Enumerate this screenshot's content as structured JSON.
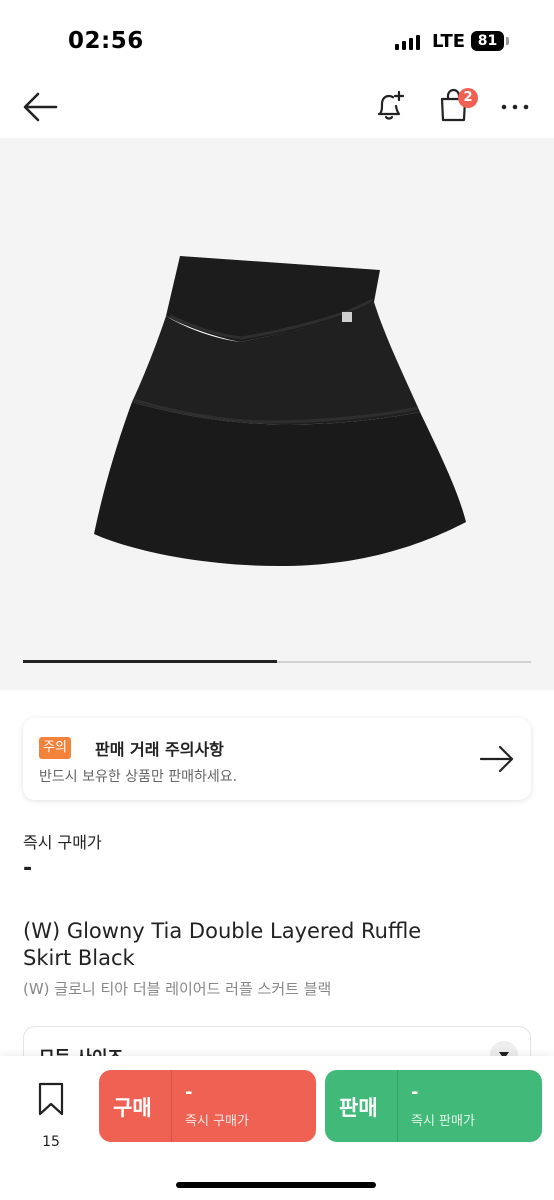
{
  "status_bar": {
    "time": "02:56",
    "network": "LTE",
    "battery": "81"
  },
  "nav": {
    "cart_badge": "2",
    "icons": [
      "back-arrow-icon",
      "bell-plus-icon",
      "shopping-bag-icon",
      "more-icon"
    ]
  },
  "carousel": {
    "progress": 0.5
  },
  "notice": {
    "tag": "주의",
    "title": "판매 거래 주의사항",
    "subtitle": "반드시 보유한 상품만 판매하세요."
  },
  "price": {
    "label": "즉시 구매가",
    "value": "-"
  },
  "product": {
    "title": "(W) Glowny Tia Double Layered Ruffle Skirt Black",
    "subtitle": "(W) 글로니 티아 더블 레이어드 러플 스커트 블랙"
  },
  "size_select": {
    "label": "모든 사이즈"
  },
  "bottom_bar": {
    "wish_count": "15",
    "buy": {
      "label": "구매",
      "price": "-",
      "sub": "즉시 구매가"
    },
    "sell": {
      "label": "판매",
      "price": "-",
      "sub": "즉시 판매가"
    }
  },
  "colors": {
    "buy": "#ef6253",
    "sell": "#41b979",
    "caution": "#f5823a"
  }
}
